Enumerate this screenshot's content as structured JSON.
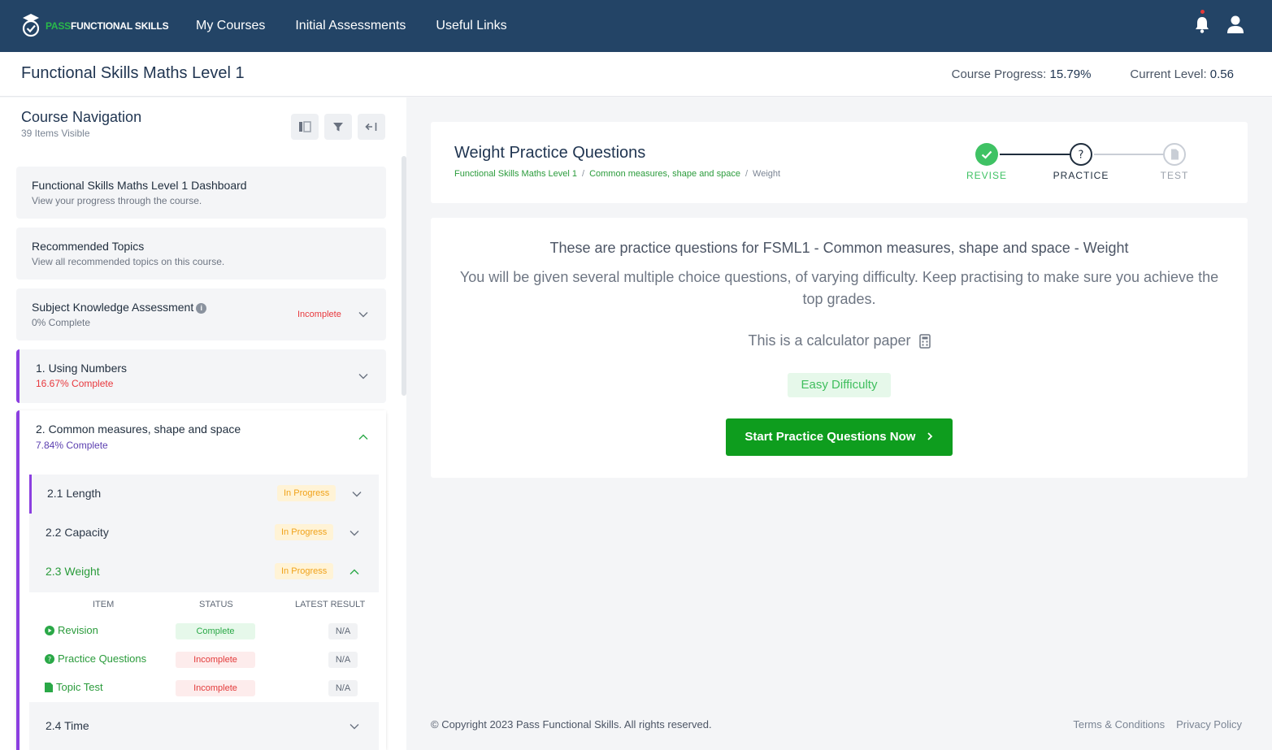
{
  "brand": {
    "pass": "PASS",
    "rest": "FUNCTIONAL SKILLS"
  },
  "nav": [
    "My Courses",
    "Initial Assessments",
    "Useful Links"
  ],
  "course": {
    "title": "Functional Skills Maths Level 1",
    "progress_label": "Course Progress:",
    "progress_value": "15.79%",
    "level_label": "Current Level:",
    "level_value": "0.56"
  },
  "sidebar": {
    "title": "Course Navigation",
    "subtitle": "39 Items Visible",
    "cards": [
      {
        "title": "Functional Skills Maths Level 1 Dashboard",
        "sub": "View your progress through the course."
      },
      {
        "title": "Recommended Topics",
        "sub": "View all recommended topics on this course."
      },
      {
        "title": "Subject Knowledge Assessment",
        "sub": "0% Complete",
        "status": "Incomplete"
      },
      {
        "title": "1. Using Numbers",
        "sub": "16.67% Complete"
      }
    ],
    "expanded": {
      "title": "2. Common measures, shape and space",
      "sub": "7.84% Complete",
      "items": [
        {
          "label": "2.1 Length",
          "status": "In Progress"
        },
        {
          "label": "2.2 Capacity",
          "status": "In Progress"
        },
        {
          "label": "2.3 Weight",
          "status": "In Progress"
        },
        {
          "label": "2.4 Time"
        }
      ],
      "table": {
        "headers": [
          "Item",
          "Status",
          "Latest Result"
        ],
        "rows": [
          {
            "item": "Revision",
            "status": "Complete",
            "result": "N/A"
          },
          {
            "item": "Practice Questions",
            "status": "Incomplete",
            "result": "N/A"
          },
          {
            "item": "Topic Test",
            "status": "Incomplete",
            "result": "N/A"
          }
        ]
      }
    }
  },
  "main": {
    "title": "Weight Practice Questions",
    "breadcrumbs": [
      "Functional Skills Maths Level 1",
      "Common measures, shape and space",
      "Weight"
    ],
    "steps": [
      "REVISE",
      "PRACTICE",
      "TEST"
    ],
    "heading": "These are practice questions for FSML1 - Common measures, shape and space - Weight",
    "description": "You will be given several multiple choice questions, of varying difficulty. Keep practising to make sure you achieve the top grades.",
    "calculator": "This is a calculator paper",
    "difficulty": "Easy Difficulty",
    "start_button": "Start Practice Questions Now"
  },
  "footer": {
    "copyright": "© Copyright 2023 Pass Functional Skills. All rights reserved.",
    "links": [
      "Terms & Conditions",
      "Privacy Policy"
    ]
  },
  "colors": {
    "navbar": "#234466",
    "accent_purple": "#8b3fe0",
    "brand_green": "#0e9d1e"
  }
}
